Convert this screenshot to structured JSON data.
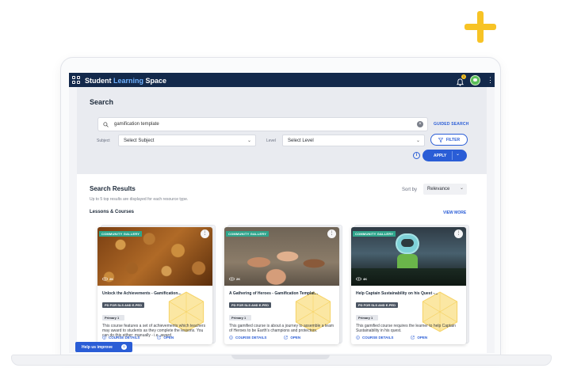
{
  "app": {
    "badge": "",
    "brand_part1": "Student ",
    "brand_part2": "Learning",
    "brand_part3": " Space",
    "notification_count": "1"
  },
  "search": {
    "title": "Search",
    "query": "gamification template",
    "guided_label": "GUIDED SEARCH",
    "subject_label": "Subject",
    "subject_value": "Select Subject",
    "level_label": "Level",
    "level_value": "Select Level",
    "filter_label": "FILTER",
    "apply_label": "APPLY"
  },
  "results": {
    "title": "Search Results",
    "subtitle": "Up to 5 top results are displayed for each resource type.",
    "sort_label": "Sort by",
    "sort_value": "Relevance",
    "section_label": "Lessons & Courses",
    "view_more": "VIEW MORE",
    "cards": [
      {
        "tag": "COMMUNITY GALLERY",
        "views": "2K",
        "title": "Unlock the Achievements - Gamification...",
        "pd_tag": "PD FOR SLS AND E-PED",
        "level": "Primary 1",
        "description": "This course features a set of achievements which teachers may award to students as they complete the lessons. You can do this either: manually - i.e. award",
        "details_label": "COURSE DETAILS",
        "open_label": "OPEN"
      },
      {
        "tag": "COMMUNITY GALLERY",
        "views": "2K",
        "title": "A Gathering of Heroes - Gamification Templat...",
        "pd_tag": "PD FOR SLS AND E-PED",
        "level": "Primary 1",
        "description": "This gamified course is about a journey to assemble a team of Heroes to be Earth's champions and protectors.",
        "details_label": "COURSE DETAILS",
        "open_label": "OPEN"
      },
      {
        "tag": "COMMUNITY GALLERY",
        "views": "4K",
        "title": "Help Captain Sustainability on his Quest -...",
        "pd_tag": "PD FOR SLS AND E-PED",
        "level": "Primary 1",
        "description": "This gamified course requires the learner to help Captain Sustainability in his quest.",
        "details_label": "COURSE DETAILS",
        "open_label": "OPEN"
      }
    ]
  },
  "help": {
    "label": "Help us improve"
  },
  "colors": {
    "nav": "#13294b",
    "accent": "#2a5dd6",
    "gallery_tag": "#2fa58c",
    "deco_plus": "#f7c325"
  },
  "icons": [
    "grid-icon",
    "bell-icon",
    "avatar",
    "kebab-icon",
    "search-icon",
    "clear-icon",
    "chevron-down-icon",
    "filter-icon",
    "info-icon",
    "eye-icon",
    "course-details-icon",
    "open-external-icon"
  ]
}
